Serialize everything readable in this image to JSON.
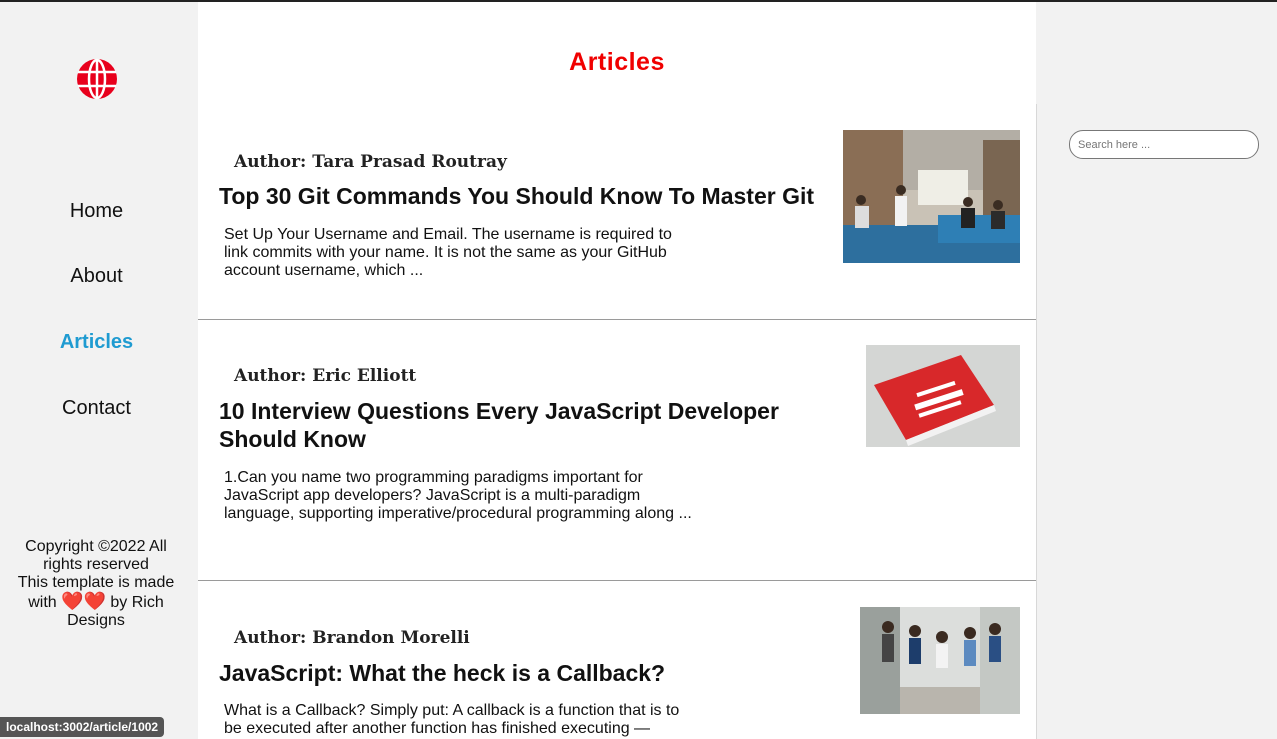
{
  "sidebar": {
    "nav": [
      {
        "label": "Home",
        "active": false
      },
      {
        "label": "About",
        "active": false
      },
      {
        "label": "Articles",
        "active": true
      },
      {
        "label": "Contact",
        "active": false
      }
    ],
    "copyright_line1": "Copyright ©2022 All rights reserved",
    "copyright_line2_pre": "This template is made with",
    "hearts": "❤️❤️",
    "copyright_line2_post": "by Rich Designs"
  },
  "main": {
    "title": "Articles",
    "articles": [
      {
        "author": "Author: Tara Prasad Routray",
        "title": "Top 30 Git Commands You Should Know To Master Git",
        "excerpt": "Set Up Your Username and Email. The username is required to link commits with your name. It is not the same as your GitHub account username, which ..."
      },
      {
        "author": "Author: Eric Elliott",
        "title": "10 Interview Questions Every JavaScript Developer Should Know",
        "excerpt": "1.Can you name two programming paradigms important for JavaScript app developers? JavaScript is a multi-paradigm language, supporting imperative/procedural programming along ..."
      },
      {
        "author": "Author: Brandon Morelli",
        "title": "JavaScript: What the heck is a Callback?",
        "excerpt": "What is a Callback? Simply put: A callback is a function that is to be executed after another function has finished executing —"
      }
    ]
  },
  "search": {
    "placeholder": "Search here ..."
  },
  "status_url": "localhost:3002/article/1002",
  "colors": {
    "title_red": "#f00000",
    "active_blue": "#1f9bd1"
  }
}
